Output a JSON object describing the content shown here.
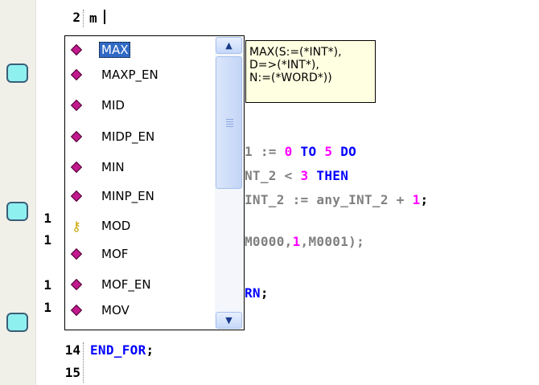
{
  "editor": {
    "typed_text": "m",
    "line_numbers": [
      "2",
      "1",
      "1",
      "1",
      "1",
      "14",
      "15"
    ],
    "code_lines": [
      [
        {
          "t": "1 := ",
          "c": "gray"
        },
        {
          "t": "0",
          "c": "num"
        },
        {
          "t": " ",
          "c": ""
        },
        {
          "t": "TO",
          "c": "kw"
        },
        {
          "t": " ",
          "c": ""
        },
        {
          "t": "5",
          "c": "num"
        },
        {
          "t": " ",
          "c": ""
        },
        {
          "t": "DO",
          "c": "kw"
        }
      ],
      [
        {
          "t": "NT_2 < ",
          "c": "gray"
        },
        {
          "t": "3",
          "c": "num"
        },
        {
          "t": " ",
          "c": ""
        },
        {
          "t": "THEN",
          "c": "kw"
        }
      ],
      [
        {
          "t": "INT_2 := any_INT_2 + ",
          "c": "gray"
        },
        {
          "t": "1",
          "c": "num"
        },
        {
          "t": ";",
          "c": ""
        }
      ],
      [
        {
          "t": "M0000,",
          "c": "gray"
        },
        {
          "t": "1",
          "c": "num"
        },
        {
          "t": ",M0001);",
          "c": "gray"
        }
      ],
      [
        {
          "t": "RN",
          "c": "kw"
        },
        {
          "t": ";",
          "c": ""
        }
      ],
      [
        {
          "t": "END_FOR",
          "c": "kw"
        },
        {
          "t": ";",
          "c": ""
        }
      ]
    ]
  },
  "autocomplete": {
    "items": [
      {
        "label": "MAX",
        "icon": "function-diamond-icon",
        "selected": true
      },
      {
        "label": "MAXP_EN",
        "icon": "function-diamond-icon"
      },
      {
        "label": "MID",
        "icon": "function-diamond-icon"
      },
      {
        "label": "MIDP_EN",
        "icon": "function-diamond-icon"
      },
      {
        "label": "MIN",
        "icon": "function-diamond-icon"
      },
      {
        "label": "MINP_EN",
        "icon": "function-diamond-icon"
      },
      {
        "label": "MOD",
        "icon": "key-icon"
      },
      {
        "label": "MOF",
        "icon": "function-diamond-icon"
      },
      {
        "label": "MOF_EN",
        "icon": "function-diamond-icon"
      },
      {
        "label": "MOV",
        "icon": "function-diamond-icon"
      }
    ],
    "scroll_up_icon": "chevron-up-icon",
    "scroll_down_icon": "chevron-down-icon"
  },
  "tooltip": {
    "lines": [
      "MAX(S:=(*INT*),",
      "D=>(*INT*),",
      "N:=(*WORD*))"
    ]
  },
  "colors": {
    "keyword": "#0000ff",
    "number": "#ff00ff",
    "identifier": "#808080",
    "selection": "#316ac5",
    "breakpoint": "#8ff0f0"
  }
}
